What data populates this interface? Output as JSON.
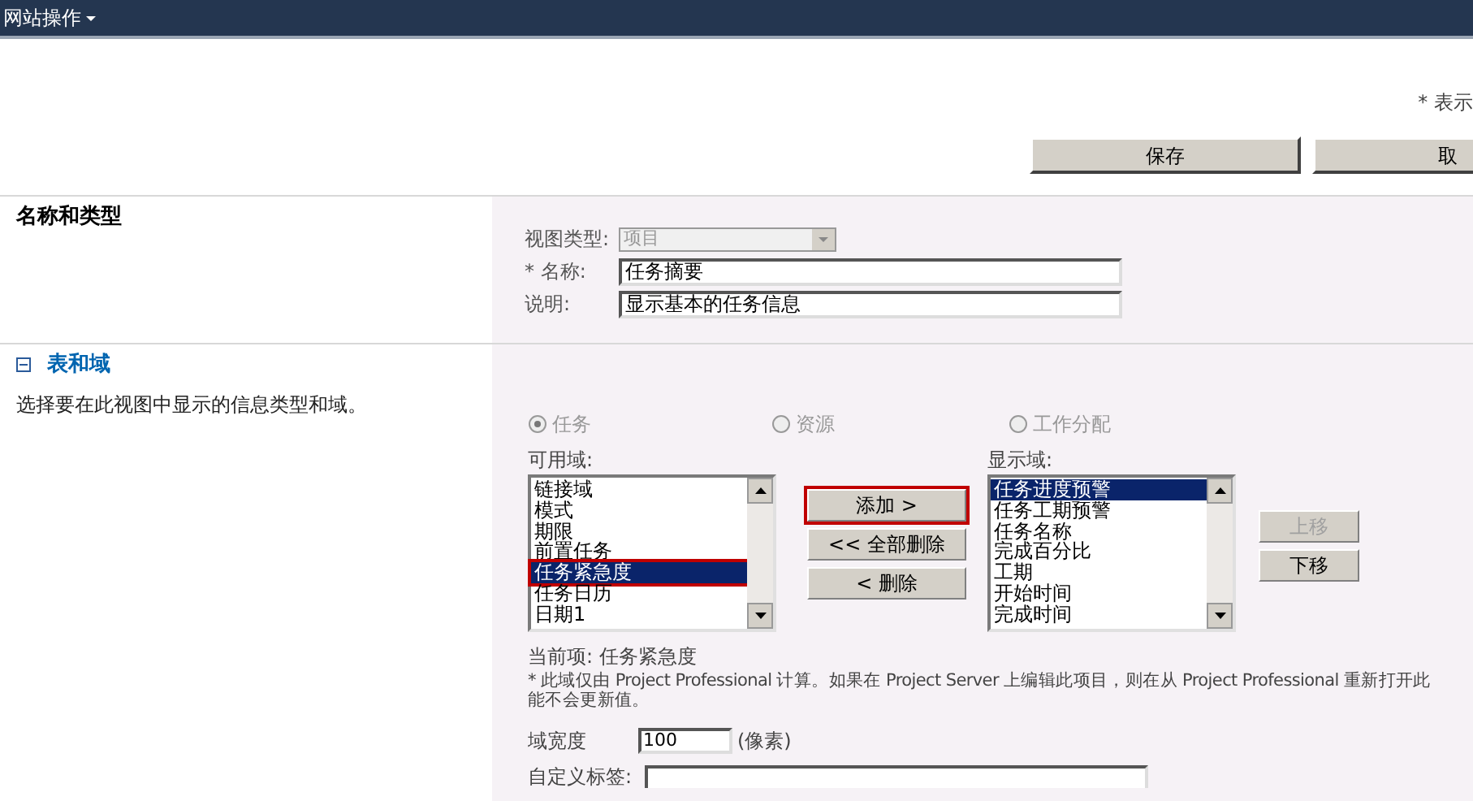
{
  "top_bar": {
    "menu": "网站操作"
  },
  "required_note": "* 表示",
  "action_buttons": [
    {
      "label": "保存"
    },
    {
      "label": "取"
    }
  ],
  "name_section": {
    "title": "名称和类型",
    "view_type": {
      "label": "视图类型:",
      "value": "项目",
      "disabled": true
    },
    "name": {
      "label": "* 名称:",
      "value": "任务摘要"
    },
    "description": {
      "label": "说明:",
      "value": "显示基本的任务信息"
    }
  },
  "table_section": {
    "title": "表和域",
    "expanded": true,
    "description": "选择要在此视图中显示的信息类型和域。",
    "radios": [
      {
        "label": "任务",
        "selected": true,
        "disabled": true
      },
      {
        "label": "资源",
        "selected": false,
        "disabled": true
      },
      {
        "label": "工作分配",
        "selected": false,
        "disabled": true
      }
    ],
    "available": {
      "label": "可用域:",
      "items": [
        {
          "text": "链接域",
          "selected": false,
          "highlighted": false
        },
        {
          "text": "模式",
          "selected": false,
          "highlighted": false
        },
        {
          "text": "期限",
          "selected": false,
          "highlighted": false
        },
        {
          "text": "前置任务",
          "selected": false,
          "highlighted": false
        },
        {
          "text": "任务紧急度",
          "selected": true,
          "highlighted": true
        },
        {
          "text": "任务日历",
          "selected": false,
          "highlighted": false
        },
        {
          "text": "日期1",
          "selected": false,
          "highlighted": false
        }
      ]
    },
    "transfer_buttons": [
      {
        "label": "添加 >",
        "highlighted": true
      },
      {
        "label": "<< 全部删除",
        "highlighted": false
      },
      {
        "label": "< 删除",
        "highlighted": false
      }
    ],
    "displayed": {
      "label": "显示域:",
      "items": [
        {
          "text": "任务进度预警",
          "selected": true
        },
        {
          "text": "任务工期预警",
          "selected": false
        },
        {
          "text": "任务名称",
          "selected": false
        },
        {
          "text": "完成百分比",
          "selected": false
        },
        {
          "text": "工期",
          "selected": false
        },
        {
          "text": "开始时间",
          "selected": false
        },
        {
          "text": "完成时间",
          "selected": false
        }
      ]
    },
    "move_buttons": [
      {
        "label": "上移",
        "disabled": true
      },
      {
        "label": "下移",
        "disabled": false
      }
    ],
    "current_item": "当前项: 任务紧急度",
    "note_lines": [
      "* 此域仅由 Project Professional 计算。如果在 Project Server 上编辑此项目，则在从 Project Professional 重新打开此",
      "能不会更新值。"
    ],
    "width": {
      "label": "域宽度",
      "value": "100",
      "unit": "(像素)"
    },
    "custom_label": {
      "label": "自定义标签:"
    }
  }
}
